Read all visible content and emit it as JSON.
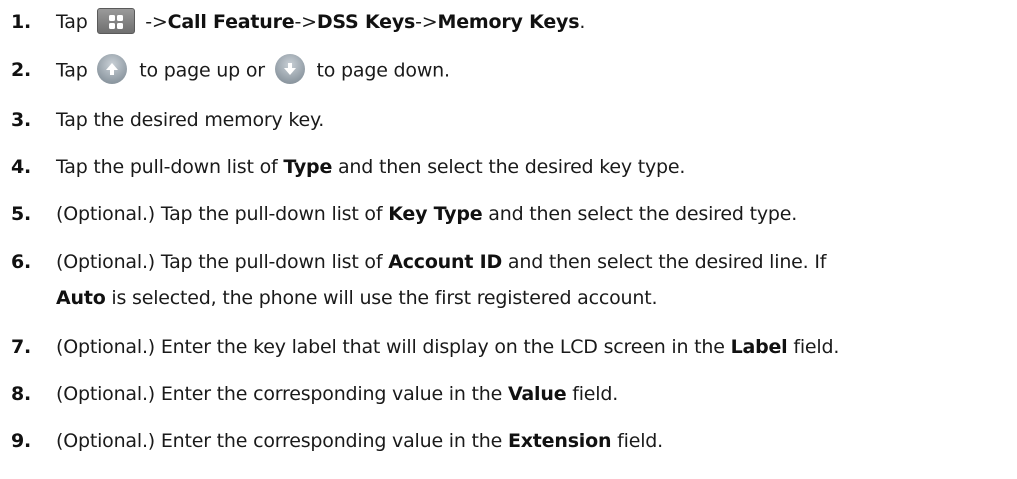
{
  "steps": [
    {
      "num": "1.",
      "pre": "Tap",
      "mid": "->",
      "b1": "Call Feature",
      "sep1": "->",
      "b2": "DSS Keys",
      "sep2": "->",
      "b3": "Memory Keys",
      "end": ".",
      "icon": "menu-grid-icon"
    },
    {
      "num": "2.",
      "pre": "Tap",
      "mid": "to page up or",
      "post": "to page down.",
      "icon_up": "arrow-up-icon",
      "icon_down": "arrow-down-icon"
    },
    {
      "num": "3.",
      "text": "Tap the desired memory key."
    },
    {
      "num": "4.",
      "pre": "Tap the pull-down list of",
      "bold": "Type",
      "post": "and then select the desired key type."
    },
    {
      "num": "5.",
      "pre": "(Optional.) Tap the pull-down list of",
      "bold": "Key Type",
      "post": "and then select the desired type."
    },
    {
      "num": "6.",
      "pre": "(Optional.) Tap the pull-down list of",
      "bold": "Account ID",
      "post": "and then select the desired line. If",
      "bold2": "Auto",
      "post2": "is selected, the phone will use the first registered account."
    },
    {
      "num": "7.",
      "pre": "(Optional.) Enter the key label that will display on the LCD screen in the",
      "bold": "Label",
      "post": "field."
    },
    {
      "num": "8.",
      "pre": "(Optional.) Enter the corresponding value in the",
      "bold": "Value",
      "post": "field."
    },
    {
      "num": "9.",
      "pre": "(Optional.) Enter the corresponding value in the",
      "bold": "Extension",
      "post": "field."
    }
  ]
}
